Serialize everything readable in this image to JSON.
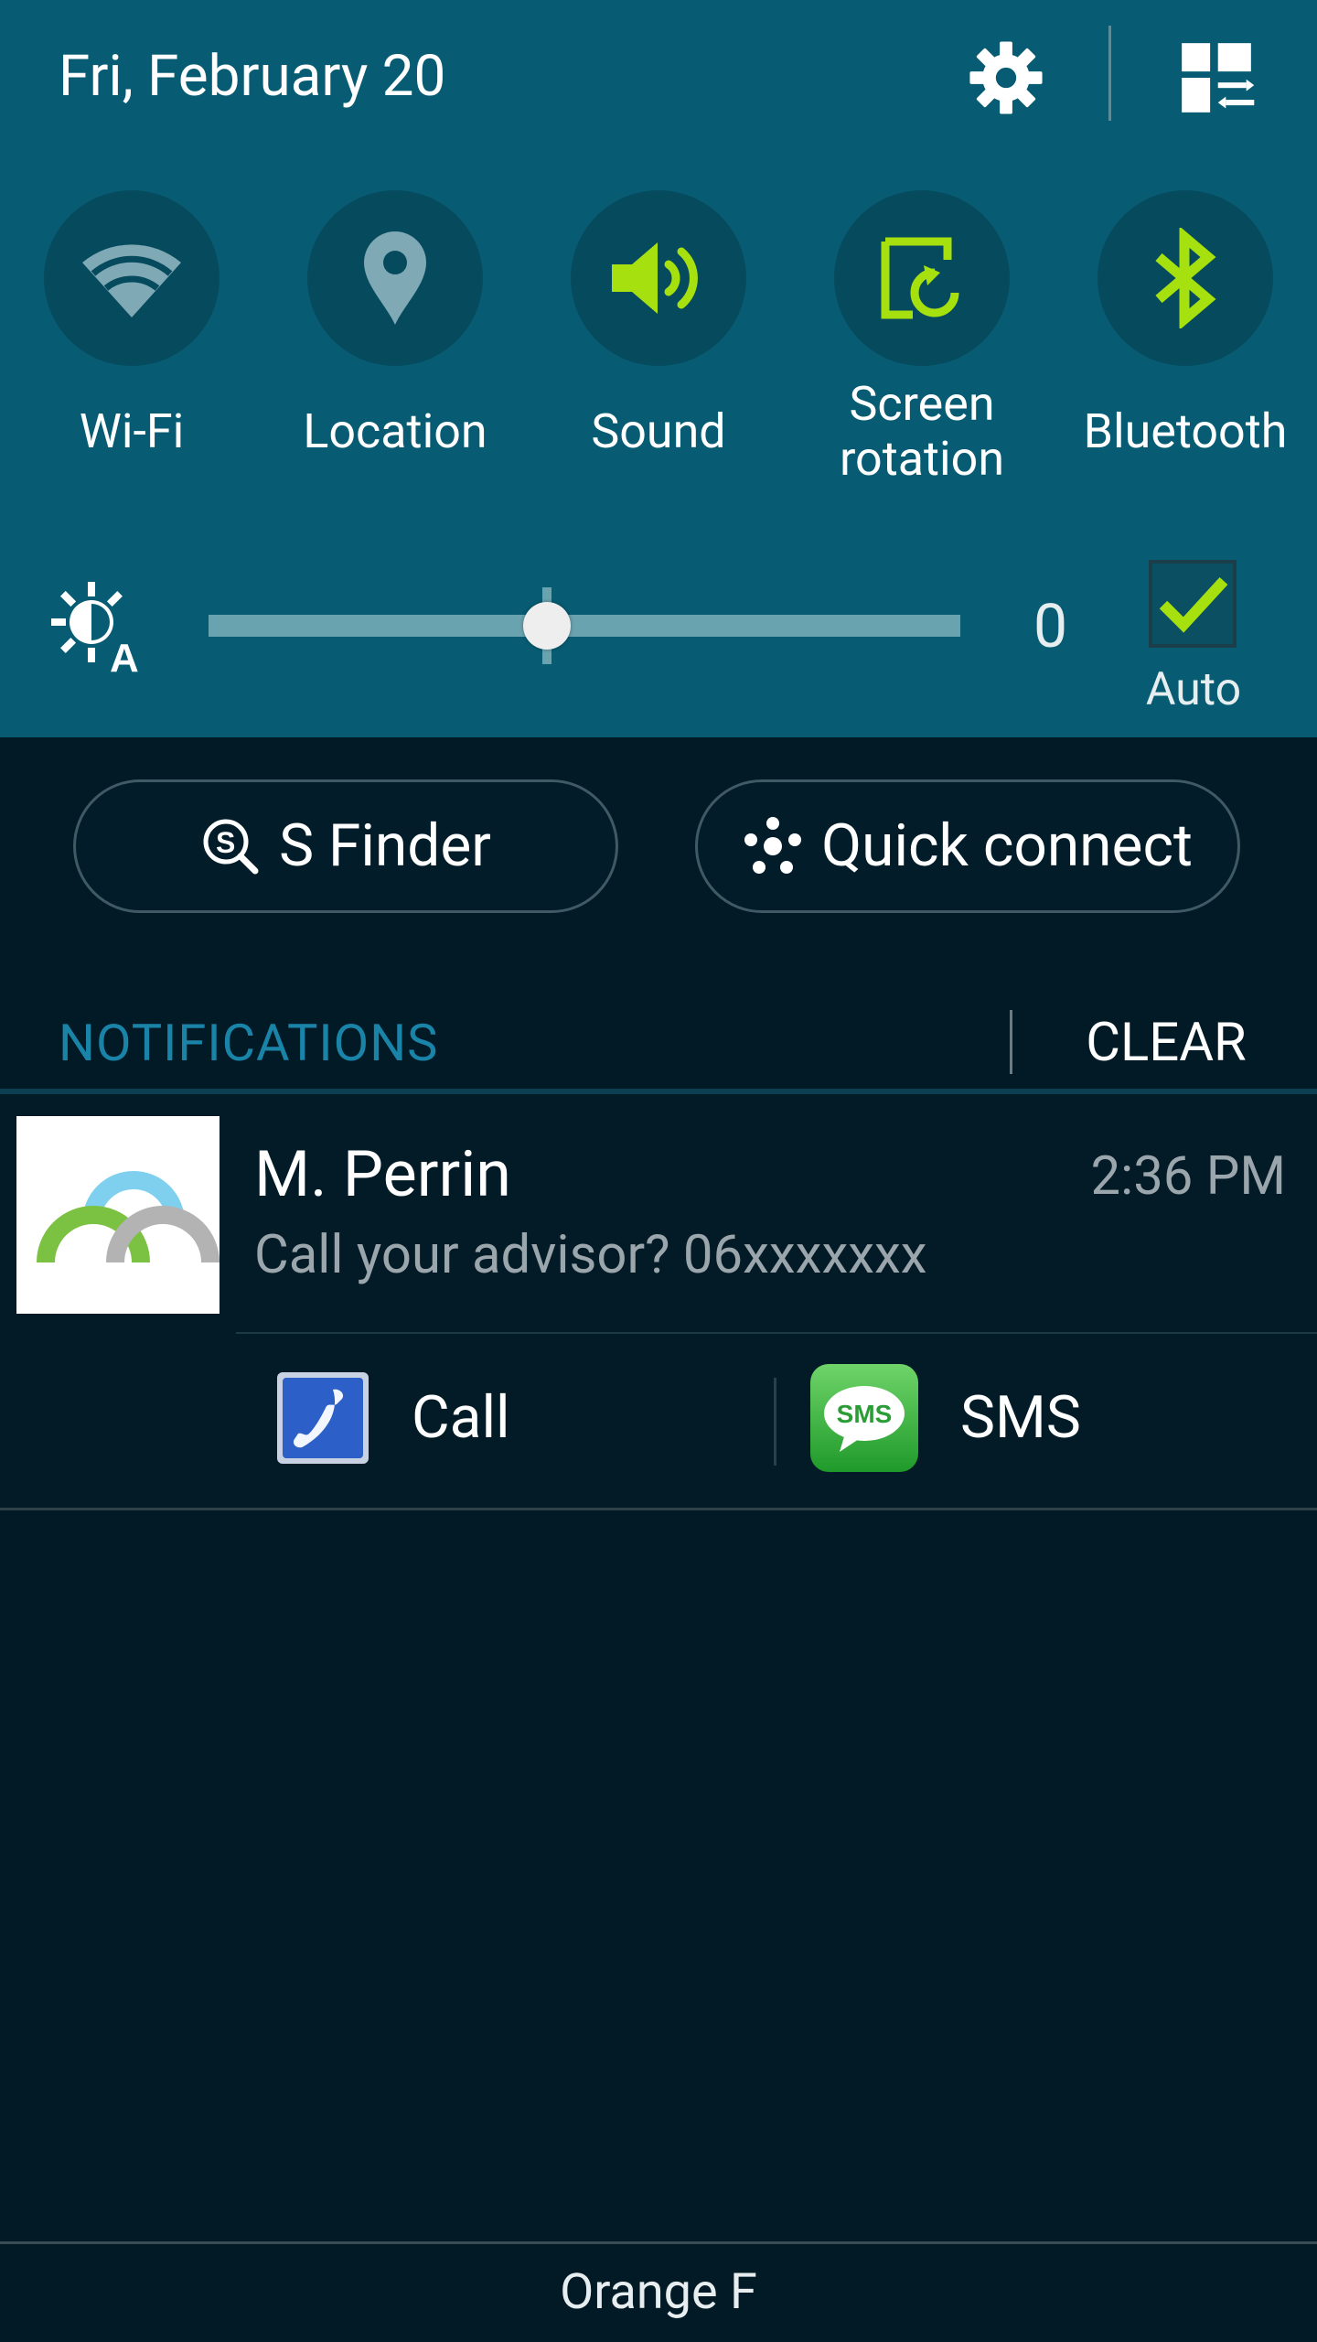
{
  "header": {
    "date": "Fri, February 20"
  },
  "quick_settings": [
    {
      "label": "Wi-Fi",
      "icon": "wifi-icon",
      "active": false
    },
    {
      "label": "Location",
      "icon": "location-pin-icon",
      "active": false
    },
    {
      "label": "Sound",
      "icon": "speaker-icon",
      "active": true
    },
    {
      "label_line1": "Screen",
      "label_line2": "rotation",
      "icon": "screen-rotation-icon",
      "active": true
    },
    {
      "label": "Bluetooth",
      "icon": "bluetooth-icon",
      "active": true
    }
  ],
  "brightness": {
    "value": "0",
    "level": 0.45,
    "auto_label": "Auto",
    "auto_checked": true
  },
  "pills": {
    "s_finder": "S Finder",
    "quick_connect": "Quick connect"
  },
  "notifications": {
    "title": "NOTIFICATIONS",
    "clear": "CLEAR",
    "items": [
      {
        "name": "M. Perrin",
        "time": "2:36 PM",
        "message": "Call your advisor? 06xxxxxxx",
        "actions": [
          {
            "label": "Call",
            "icon": "phone-app-icon"
          },
          {
            "label": "SMS",
            "icon": "sms-app-icon"
          }
        ]
      }
    ]
  },
  "footer": {
    "carrier": "Orange F"
  },
  "colors": {
    "panel_bg": "#075c73",
    "tile_bg": "#064a5d",
    "active_green": "#a6e00f",
    "inactive_icon": "#7fa9b4",
    "accent_blue": "#1a84a8",
    "body_bg": "#011a26"
  }
}
